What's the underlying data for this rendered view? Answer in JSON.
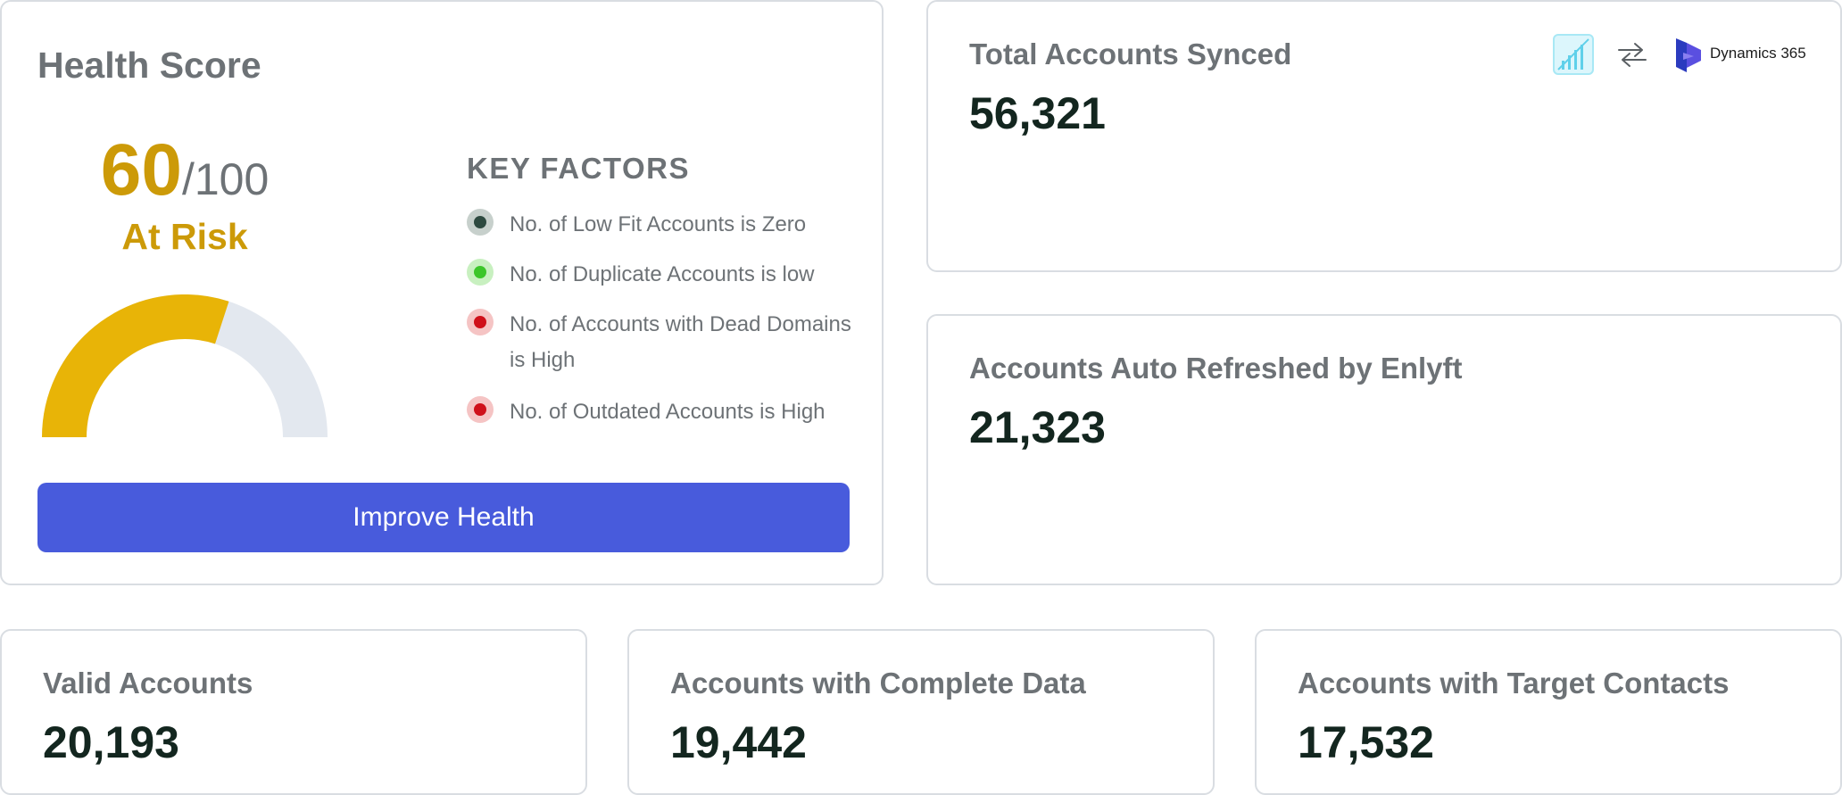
{
  "health": {
    "title": "Health Score",
    "score": "60",
    "score_max": "/100",
    "status": "At Risk",
    "score_fraction": 0.6,
    "key_factors_title": "KEY FACTORS",
    "factors": [
      {
        "text": "No. of Low Fit Accounts is Zero",
        "status_color": "#2e4a40"
      },
      {
        "text": "No. of Duplicate Accounts is low",
        "status_color": "#3cc62a"
      },
      {
        "text": "No. of Accounts with Dead Domains is High",
        "status_color": "#cf101a"
      },
      {
        "text": "No. of Outdated Accounts is High",
        "status_color": "#cf101a"
      }
    ],
    "improve_button": "Improve Health"
  },
  "stats": {
    "total_synced": {
      "label": "Total Accounts Synced",
      "value": "56,321"
    },
    "auto_refreshed": {
      "label": "Accounts Auto Refreshed by Enlyft",
      "value": "21,323"
    },
    "valid": {
      "label": "Valid Accounts",
      "value": "20,193"
    },
    "complete": {
      "label": "Accounts with Complete Data",
      "value": "19,442"
    },
    "target_contacts": {
      "label": "Accounts with Target Contacts",
      "value": "17,532"
    }
  },
  "integration": {
    "source_icon": "chart-bars-icon",
    "sync_icon": "arrows-sync-icon",
    "target_icon": "dynamics-365-icon",
    "target_label": "Dynamics 365"
  },
  "colors": {
    "accent": "#485bdc",
    "at_risk": "#cc9a08",
    "gauge_fill": "#e8b407",
    "gauge_track": "#e3e8ef",
    "value_text": "#13261f",
    "label_text": "#6d7276"
  }
}
